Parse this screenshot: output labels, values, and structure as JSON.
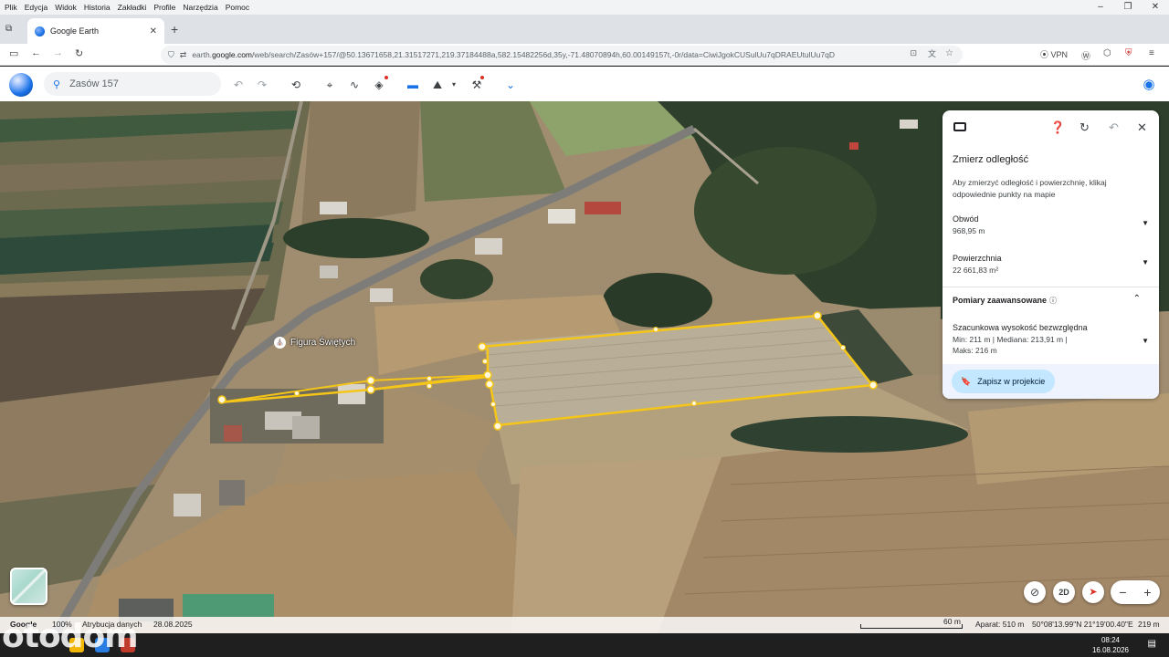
{
  "menubar": {
    "items": [
      "Plik",
      "Edycja",
      "Widok",
      "Historia",
      "Zakładki",
      "Profile",
      "Narzędzia",
      "Pomoc"
    ],
    "window_controls": [
      "–",
      "❐",
      "✕"
    ]
  },
  "tabs": [
    {
      "title": "Google Earth",
      "close": "✕"
    }
  ],
  "new_tab_label": "+",
  "address": {
    "scheme": "earth.",
    "host": "google.com",
    "path": "/web/search/Zasów+157/@50.13671658,21.31517271,219.37184488a,582.15482256d,35y,-71.48070894h,60.00149157t,-0r/data=CiwiJgokCUSulUu7qDRAEUtulUu7qD",
    "vpn_label": "VPN"
  },
  "earth": {
    "search_placeholder": "Zasów 157"
  },
  "map": {
    "place_label": "Figura Świętych"
  },
  "measure_panel": {
    "title": "Zmierz odległość",
    "description": "Aby zmierzyć odległość i powierzchnię, klikaj odpowiednie punkty na mapie",
    "perimeter_label": "Obwód",
    "perimeter_value": "968,95 m",
    "area_label": "Powierzchnia",
    "area_value": "22 661,83 m²",
    "advanced_label": "Pomiary zaawansowane",
    "elevation_label": "Szacunkowa wysokość bezwzględna",
    "elevation_line1": "Min: 211 m | Mediana: 213,91 m |",
    "elevation_line2": "Maks: 216 m",
    "save_label": "Zapisz w projekcie"
  },
  "controls": {
    "view_2d_label": "2D",
    "zoom_out": "−",
    "zoom_in": "+"
  },
  "statusbar": {
    "google_label": "Google",
    "percent": "100%",
    "attribution": "Atrybucja danych",
    "date": "28.08.2025",
    "scale_label": "60 m",
    "camera": "Aparat: 510 m",
    "coordinates": "50°08'13.99\"N 21°19'00.40\"E",
    "altitude": "219 m"
  },
  "taskbar": {
    "time": "08:24",
    "date": "16.08.2026"
  },
  "watermark": "otodom",
  "colors": {
    "measure_line": "#f5c518",
    "accent": "#1a73e8",
    "save_button_bg": "#c2e7ff"
  }
}
